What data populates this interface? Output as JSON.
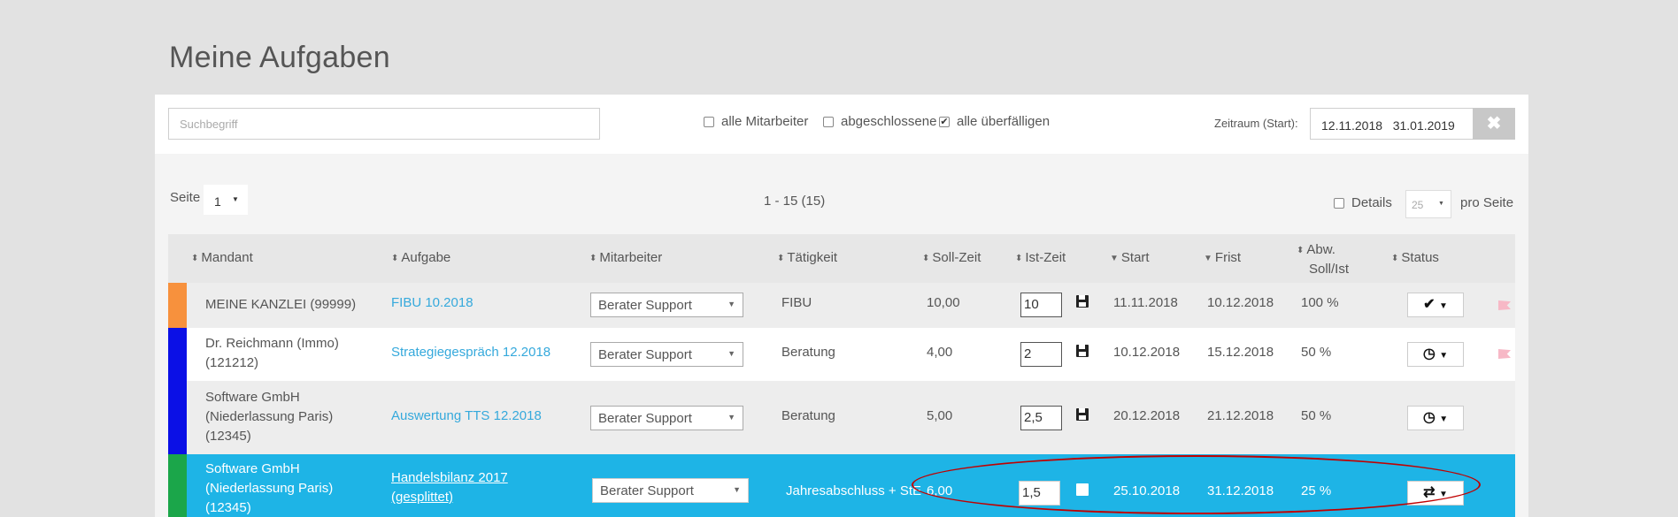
{
  "title": "Meine Aufgaben",
  "filters": {
    "search_placeholder": "Suchbegriff",
    "alle_mitarbeiter": "alle Mitarbeiter",
    "abgeschlossene": "abgeschlossene",
    "alle_ueberfaelligen": "alle überfälligen",
    "checked": {
      "alle_mitarbeiter": false,
      "abgeschlossene": false,
      "alle_ueberfaelligen": true
    },
    "zeitraum_label": "Zeitraum (Start):",
    "date_from": "12.11.2018",
    "date_to": "31.01.2019",
    "clear_label": "✖"
  },
  "pager": {
    "seite_label": "Seite",
    "page": "1",
    "range": "1 - 15 (15)",
    "details_label": "Details",
    "per_page": "25",
    "pro_seite": "pro Seite"
  },
  "columns": {
    "mandant": "Mandant",
    "aufgabe": "Aufgabe",
    "mitarbeiter": "Mitarbeiter",
    "taetigkeit": "Tätigkeit",
    "soll_zeit": "Soll-Zeit",
    "ist_zeit": "Ist-Zeit",
    "start": "Start",
    "frist": "Frist",
    "abw_1": "Abw.",
    "abw_2": "Soll/Ist",
    "status": "Status"
  },
  "rows": [
    {
      "mandant_lines": [
        "MEINE KANZLEI (99999)"
      ],
      "aufgabe_lines": [
        "FIBU 10.2018"
      ],
      "mitarbeiter": "Berater Support",
      "taetigkeit": "FIBU",
      "soll": "10,00",
      "ist": "10",
      "start": "11.11.2018",
      "frist": "10.12.2018",
      "abw": "100 %",
      "status_icon": "✔",
      "color": "#f7913d",
      "flag": true
    },
    {
      "mandant_lines": [
        "Dr. Reichmann (Immo)",
        "(121212)"
      ],
      "aufgabe_lines": [
        "Strategiegespräch 12.2018"
      ],
      "mitarbeiter": "Berater Support",
      "taetigkeit": "Beratung",
      "soll": "4,00",
      "ist": "2",
      "start": "10.12.2018",
      "frist": "15.12.2018",
      "abw": "50 %",
      "status_icon": "◷",
      "color": "#0b10e6",
      "flag": true
    },
    {
      "mandant_lines": [
        "Software GmbH",
        "(Niederlassung Paris)",
        "(12345)"
      ],
      "aufgabe_lines": [
        "Auswertung TTS 12.2018"
      ],
      "mitarbeiter": "Berater Support",
      "taetigkeit": "Beratung",
      "soll": "5,00",
      "ist": "2,5",
      "start": "20.12.2018",
      "frist": "21.12.2018",
      "abw": "50 %",
      "status_icon": "◷",
      "color": "#0b10e6",
      "flag": false
    },
    {
      "mandant_lines": [
        "Software GmbH",
        "(Niederlassung Paris)",
        "(12345)"
      ],
      "aufgabe_lines": [
        "Handelsbilanz 2017",
        "(gesplittet)"
      ],
      "mitarbeiter": "Berater Support",
      "taetigkeit": "Jahresabschluss + StE",
      "soll": "6,00",
      "ist": "1,5",
      "start": "25.10.2018",
      "frist": "31.12.2018",
      "abw": "25 %",
      "status_icon": "⇄",
      "color": "#1ba64a",
      "flag": false
    }
  ],
  "colors": {
    "selected_row": "#1eb4e6",
    "link": "#35a9dc",
    "highlight_ellipse": "#c00000"
  }
}
